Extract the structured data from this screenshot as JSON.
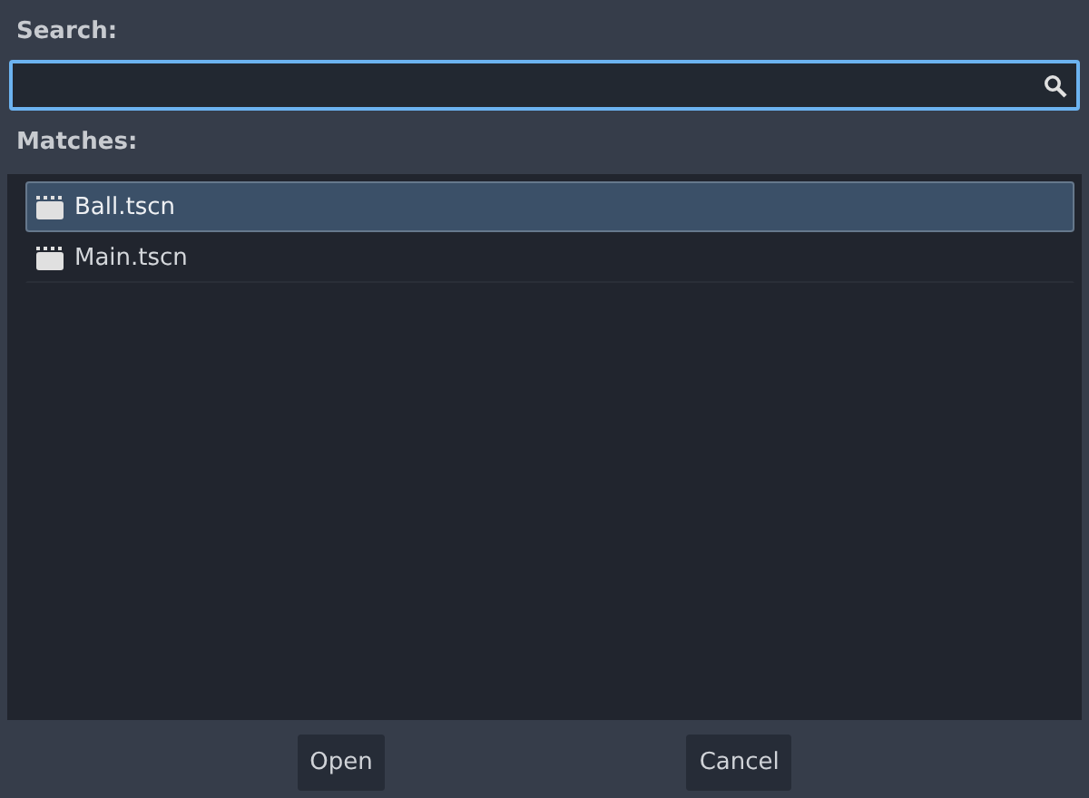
{
  "search": {
    "label": "Search:",
    "focused": true
  },
  "matches": {
    "label": "Matches:",
    "items": [
      {
        "name": "Ball.tscn",
        "selected": true
      },
      {
        "name": "Main.tscn",
        "selected": false
      }
    ]
  },
  "buttons": [
    "Open",
    "Cancel"
  ]
}
